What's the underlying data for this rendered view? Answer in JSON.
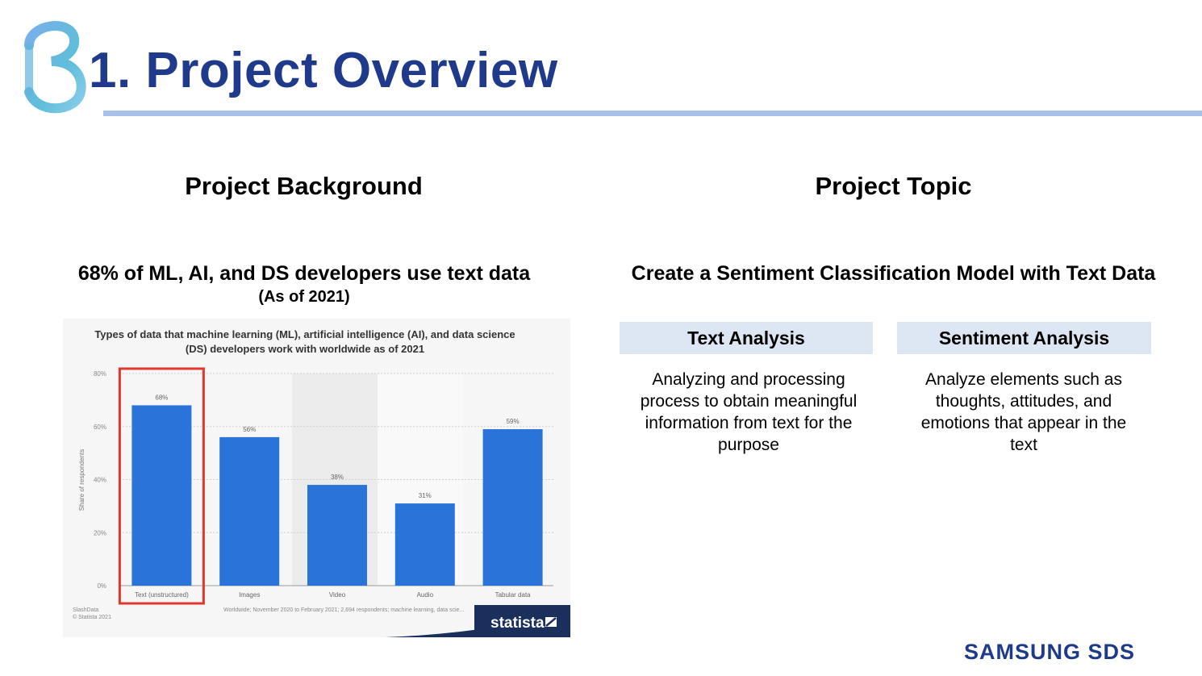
{
  "header": {
    "title": "1. Project Overview"
  },
  "left": {
    "heading": "Project Background",
    "subheading": "68% of ML, AI, and DS developers use text data",
    "note": "(As of 2021)"
  },
  "right": {
    "heading": "Project Topic",
    "subheading": "Create a Sentiment Classification Model with Text Data",
    "cards": [
      {
        "title": "Text Analysis",
        "lines": [
          "Analyzing and processing",
          "process to obtain meaningful",
          "information from text for the",
          "purpose"
        ]
      },
      {
        "title": "Sentiment Analysis",
        "lines": [
          "Analyze elements such as",
          "thoughts, attitudes, and",
          "emotions that appear in the",
          "text"
        ]
      }
    ]
  },
  "footer": {
    "brand": "SAMSUNG SDS"
  },
  "colors": {
    "title": "#1f3a8a",
    "rule": "#a9c0ea",
    "bar": "#2a74d9",
    "highlight": "#e0382e",
    "card_header_bg": "#dde7f4"
  },
  "chart_data": {
    "type": "bar",
    "title_lines": [
      "Types of data that machine learning (ML), artificial intelligence (AI), and data science",
      "(DS) developers work with worldwide as of 2021"
    ],
    "ylabel": "Share of respondents",
    "categories": [
      "Text (unstructured)",
      "Images",
      "Video",
      "Audio",
      "Tabular data"
    ],
    "values": [
      68,
      56,
      38,
      31,
      59
    ],
    "value_labels": [
      "68%",
      "56%",
      "38%",
      "31%",
      "59%"
    ],
    "yticks": [
      "0%",
      "20%",
      "40%",
      "60%",
      "80%"
    ],
    "ylim": [
      0,
      80
    ],
    "highlighted_category": "Text (unstructured)",
    "source_lines": [
      "SlashData",
      "© Statista 2021"
    ],
    "footnote": "Worldwide; November 2020 to February 2021; 2,694 respondents; machine learning, data scie...",
    "watermark": "statista"
  }
}
